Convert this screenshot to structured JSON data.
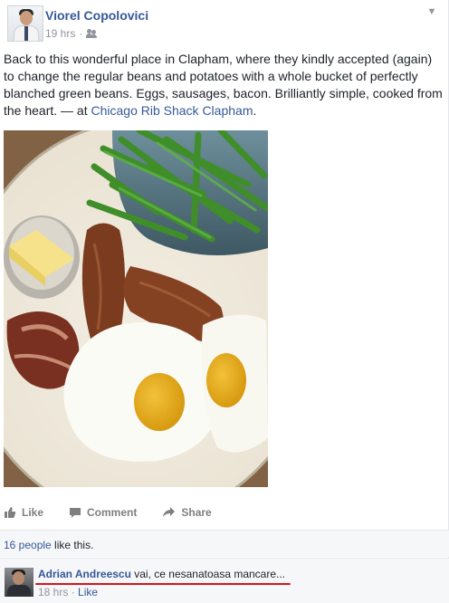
{
  "post": {
    "author": "Viorel Copolovici",
    "time": "19 hrs",
    "separator": "·",
    "privacy_icon": "friends-icon",
    "options_icon": "chevron-down-icon",
    "text_main": "Back to this wonderful place in Clapham, where they kindly accepted (again) to change the regular beans and potatoes with a whole bucket of perfectly blanched green beans. Eggs, sausages, bacon. Brilliantly simple, cooked from the heart. — at ",
    "location": "Chicago Rib Shack Clapham",
    "text_end": "."
  },
  "actions": {
    "like": "Like",
    "comment": "Comment",
    "share": "Share"
  },
  "likes": {
    "count": "16 people",
    "suffix": " like this."
  },
  "comment": {
    "author": "Adrian Andreescu",
    "text": " vai, ce nesanatoasa mancare...",
    "time": "18 hrs",
    "separator": " · ",
    "like": "Like"
  },
  "colors": {
    "link": "#365899",
    "meta": "#90949c",
    "underline": "#e0101a"
  }
}
